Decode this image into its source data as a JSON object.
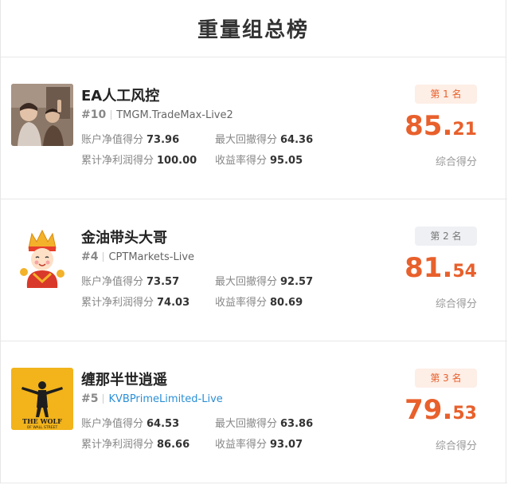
{
  "page": {
    "title": "重量组总榜"
  },
  "entries": [
    {
      "name": "EA人工风控",
      "rank": "#10",
      "broker": "TMGM.TradeMax-Live2",
      "badge": "第 1 名",
      "score_int": "85",
      "score_dec": "21",
      "score_label": "综合得分",
      "stats": {
        "equity_label": "账户净值得分",
        "equity": "73.96",
        "drawdown_label": "最大回撤得分",
        "drawdown": "64.36",
        "profit_label": "累计净利润得分",
        "profit": "100.00",
        "yield_label": "收益率得分",
        "yield": "95.05"
      },
      "avatar": "photo-of-children-icon"
    },
    {
      "name": "金油带头大哥",
      "rank": "#4",
      "broker": "CPTMarkets-Live",
      "badge": "第 2 名",
      "score_int": "81",
      "score_dec": "54",
      "score_label": "综合得分",
      "stats": {
        "equity_label": "账户净值得分",
        "equity": "73.57",
        "drawdown_label": "最大回撤得分",
        "drawdown": "92.57",
        "profit_label": "累计净利润得分",
        "profit": "74.03",
        "yield_label": "收益率得分",
        "yield": "80.69"
      },
      "avatar": "god-of-wealth-cartoon-icon"
    },
    {
      "name": "缠那半世逍遥",
      "rank": "#5",
      "broker": "KVBPrimeLimited-Live",
      "badge": "第 3 名",
      "score_int": "79",
      "score_dec": "53",
      "score_label": "综合得分",
      "stats": {
        "equity_label": "账户净值得分",
        "equity": "64.53",
        "drawdown_label": "最大回撤得分",
        "drawdown": "63.86",
        "profit_label": "累计净利润得分",
        "profit": "86.66",
        "yield_label": "收益率得分",
        "yield": "93.07"
      },
      "avatar": "wolf-of-wall-street-poster-icon",
      "avatar_text": [
        "THE WOLF",
        "OF WALL STREET"
      ]
    }
  ],
  "colors": {
    "accent": "#e8602c",
    "link": "#2b8fd6",
    "poster_yellow": "#f2b31b"
  }
}
